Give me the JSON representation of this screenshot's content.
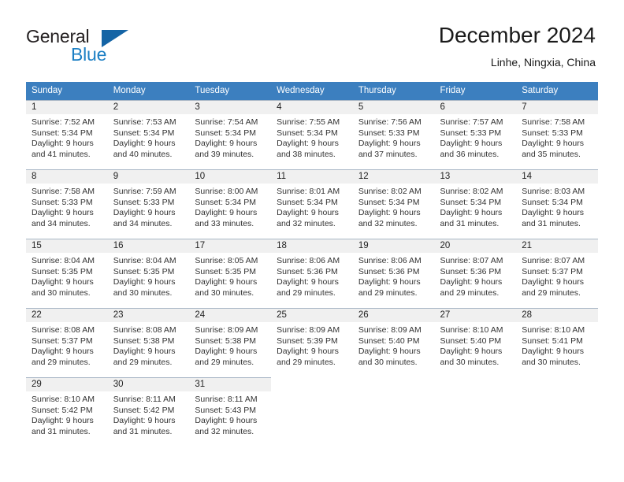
{
  "brand": {
    "word1": "General",
    "word2": "Blue",
    "logo_color": "#1464a5",
    "blue_text_color": "#1c7fc4"
  },
  "header": {
    "title": "December 2024",
    "subtitle": "Linhe, Ningxia, China",
    "header_bg": "#3c7fbf",
    "daynum_bg": "#f0f0f0"
  },
  "weekday_headers": [
    "Sunday",
    "Monday",
    "Tuesday",
    "Wednesday",
    "Thursday",
    "Friday",
    "Saturday"
  ],
  "weeks": [
    [
      {
        "day": "1",
        "sunrise": "Sunrise: 7:52 AM",
        "sunset": "Sunset: 5:34 PM",
        "daylight1": "Daylight: 9 hours",
        "daylight2": "and 41 minutes."
      },
      {
        "day": "2",
        "sunrise": "Sunrise: 7:53 AM",
        "sunset": "Sunset: 5:34 PM",
        "daylight1": "Daylight: 9 hours",
        "daylight2": "and 40 minutes."
      },
      {
        "day": "3",
        "sunrise": "Sunrise: 7:54 AM",
        "sunset": "Sunset: 5:34 PM",
        "daylight1": "Daylight: 9 hours",
        "daylight2": "and 39 minutes."
      },
      {
        "day": "4",
        "sunrise": "Sunrise: 7:55 AM",
        "sunset": "Sunset: 5:34 PM",
        "daylight1": "Daylight: 9 hours",
        "daylight2": "and 38 minutes."
      },
      {
        "day": "5",
        "sunrise": "Sunrise: 7:56 AM",
        "sunset": "Sunset: 5:33 PM",
        "daylight1": "Daylight: 9 hours",
        "daylight2": "and 37 minutes."
      },
      {
        "day": "6",
        "sunrise": "Sunrise: 7:57 AM",
        "sunset": "Sunset: 5:33 PM",
        "daylight1": "Daylight: 9 hours",
        "daylight2": "and 36 minutes."
      },
      {
        "day": "7",
        "sunrise": "Sunrise: 7:58 AM",
        "sunset": "Sunset: 5:33 PM",
        "daylight1": "Daylight: 9 hours",
        "daylight2": "and 35 minutes."
      }
    ],
    [
      {
        "day": "8",
        "sunrise": "Sunrise: 7:58 AM",
        "sunset": "Sunset: 5:33 PM",
        "daylight1": "Daylight: 9 hours",
        "daylight2": "and 34 minutes."
      },
      {
        "day": "9",
        "sunrise": "Sunrise: 7:59 AM",
        "sunset": "Sunset: 5:33 PM",
        "daylight1": "Daylight: 9 hours",
        "daylight2": "and 34 minutes."
      },
      {
        "day": "10",
        "sunrise": "Sunrise: 8:00 AM",
        "sunset": "Sunset: 5:34 PM",
        "daylight1": "Daylight: 9 hours",
        "daylight2": "and 33 minutes."
      },
      {
        "day": "11",
        "sunrise": "Sunrise: 8:01 AM",
        "sunset": "Sunset: 5:34 PM",
        "daylight1": "Daylight: 9 hours",
        "daylight2": "and 32 minutes."
      },
      {
        "day": "12",
        "sunrise": "Sunrise: 8:02 AM",
        "sunset": "Sunset: 5:34 PM",
        "daylight1": "Daylight: 9 hours",
        "daylight2": "and 32 minutes."
      },
      {
        "day": "13",
        "sunrise": "Sunrise: 8:02 AM",
        "sunset": "Sunset: 5:34 PM",
        "daylight1": "Daylight: 9 hours",
        "daylight2": "and 31 minutes."
      },
      {
        "day": "14",
        "sunrise": "Sunrise: 8:03 AM",
        "sunset": "Sunset: 5:34 PM",
        "daylight1": "Daylight: 9 hours",
        "daylight2": "and 31 minutes."
      }
    ],
    [
      {
        "day": "15",
        "sunrise": "Sunrise: 8:04 AM",
        "sunset": "Sunset: 5:35 PM",
        "daylight1": "Daylight: 9 hours",
        "daylight2": "and 30 minutes."
      },
      {
        "day": "16",
        "sunrise": "Sunrise: 8:04 AM",
        "sunset": "Sunset: 5:35 PM",
        "daylight1": "Daylight: 9 hours",
        "daylight2": "and 30 minutes."
      },
      {
        "day": "17",
        "sunrise": "Sunrise: 8:05 AM",
        "sunset": "Sunset: 5:35 PM",
        "daylight1": "Daylight: 9 hours",
        "daylight2": "and 30 minutes."
      },
      {
        "day": "18",
        "sunrise": "Sunrise: 8:06 AM",
        "sunset": "Sunset: 5:36 PM",
        "daylight1": "Daylight: 9 hours",
        "daylight2": "and 29 minutes."
      },
      {
        "day": "19",
        "sunrise": "Sunrise: 8:06 AM",
        "sunset": "Sunset: 5:36 PM",
        "daylight1": "Daylight: 9 hours",
        "daylight2": "and 29 minutes."
      },
      {
        "day": "20",
        "sunrise": "Sunrise: 8:07 AM",
        "sunset": "Sunset: 5:36 PM",
        "daylight1": "Daylight: 9 hours",
        "daylight2": "and 29 minutes."
      },
      {
        "day": "21",
        "sunrise": "Sunrise: 8:07 AM",
        "sunset": "Sunset: 5:37 PM",
        "daylight1": "Daylight: 9 hours",
        "daylight2": "and 29 minutes."
      }
    ],
    [
      {
        "day": "22",
        "sunrise": "Sunrise: 8:08 AM",
        "sunset": "Sunset: 5:37 PM",
        "daylight1": "Daylight: 9 hours",
        "daylight2": "and 29 minutes."
      },
      {
        "day": "23",
        "sunrise": "Sunrise: 8:08 AM",
        "sunset": "Sunset: 5:38 PM",
        "daylight1": "Daylight: 9 hours",
        "daylight2": "and 29 minutes."
      },
      {
        "day": "24",
        "sunrise": "Sunrise: 8:09 AM",
        "sunset": "Sunset: 5:38 PM",
        "daylight1": "Daylight: 9 hours",
        "daylight2": "and 29 minutes."
      },
      {
        "day": "25",
        "sunrise": "Sunrise: 8:09 AM",
        "sunset": "Sunset: 5:39 PM",
        "daylight1": "Daylight: 9 hours",
        "daylight2": "and 29 minutes."
      },
      {
        "day": "26",
        "sunrise": "Sunrise: 8:09 AM",
        "sunset": "Sunset: 5:40 PM",
        "daylight1": "Daylight: 9 hours",
        "daylight2": "and 30 minutes."
      },
      {
        "day": "27",
        "sunrise": "Sunrise: 8:10 AM",
        "sunset": "Sunset: 5:40 PM",
        "daylight1": "Daylight: 9 hours",
        "daylight2": "and 30 minutes."
      },
      {
        "day": "28",
        "sunrise": "Sunrise: 8:10 AM",
        "sunset": "Sunset: 5:41 PM",
        "daylight1": "Daylight: 9 hours",
        "daylight2": "and 30 minutes."
      }
    ],
    [
      {
        "day": "29",
        "sunrise": "Sunrise: 8:10 AM",
        "sunset": "Sunset: 5:42 PM",
        "daylight1": "Daylight: 9 hours",
        "daylight2": "and 31 minutes."
      },
      {
        "day": "30",
        "sunrise": "Sunrise: 8:11 AM",
        "sunset": "Sunset: 5:42 PM",
        "daylight1": "Daylight: 9 hours",
        "daylight2": "and 31 minutes."
      },
      {
        "day": "31",
        "sunrise": "Sunrise: 8:11 AM",
        "sunset": "Sunset: 5:43 PM",
        "daylight1": "Daylight: 9 hours",
        "daylight2": "and 32 minutes."
      },
      {
        "day": "",
        "sunrise": "",
        "sunset": "",
        "daylight1": "",
        "daylight2": ""
      },
      {
        "day": "",
        "sunrise": "",
        "sunset": "",
        "daylight1": "",
        "daylight2": ""
      },
      {
        "day": "",
        "sunrise": "",
        "sunset": "",
        "daylight1": "",
        "daylight2": ""
      },
      {
        "day": "",
        "sunrise": "",
        "sunset": "",
        "daylight1": "",
        "daylight2": ""
      }
    ]
  ]
}
